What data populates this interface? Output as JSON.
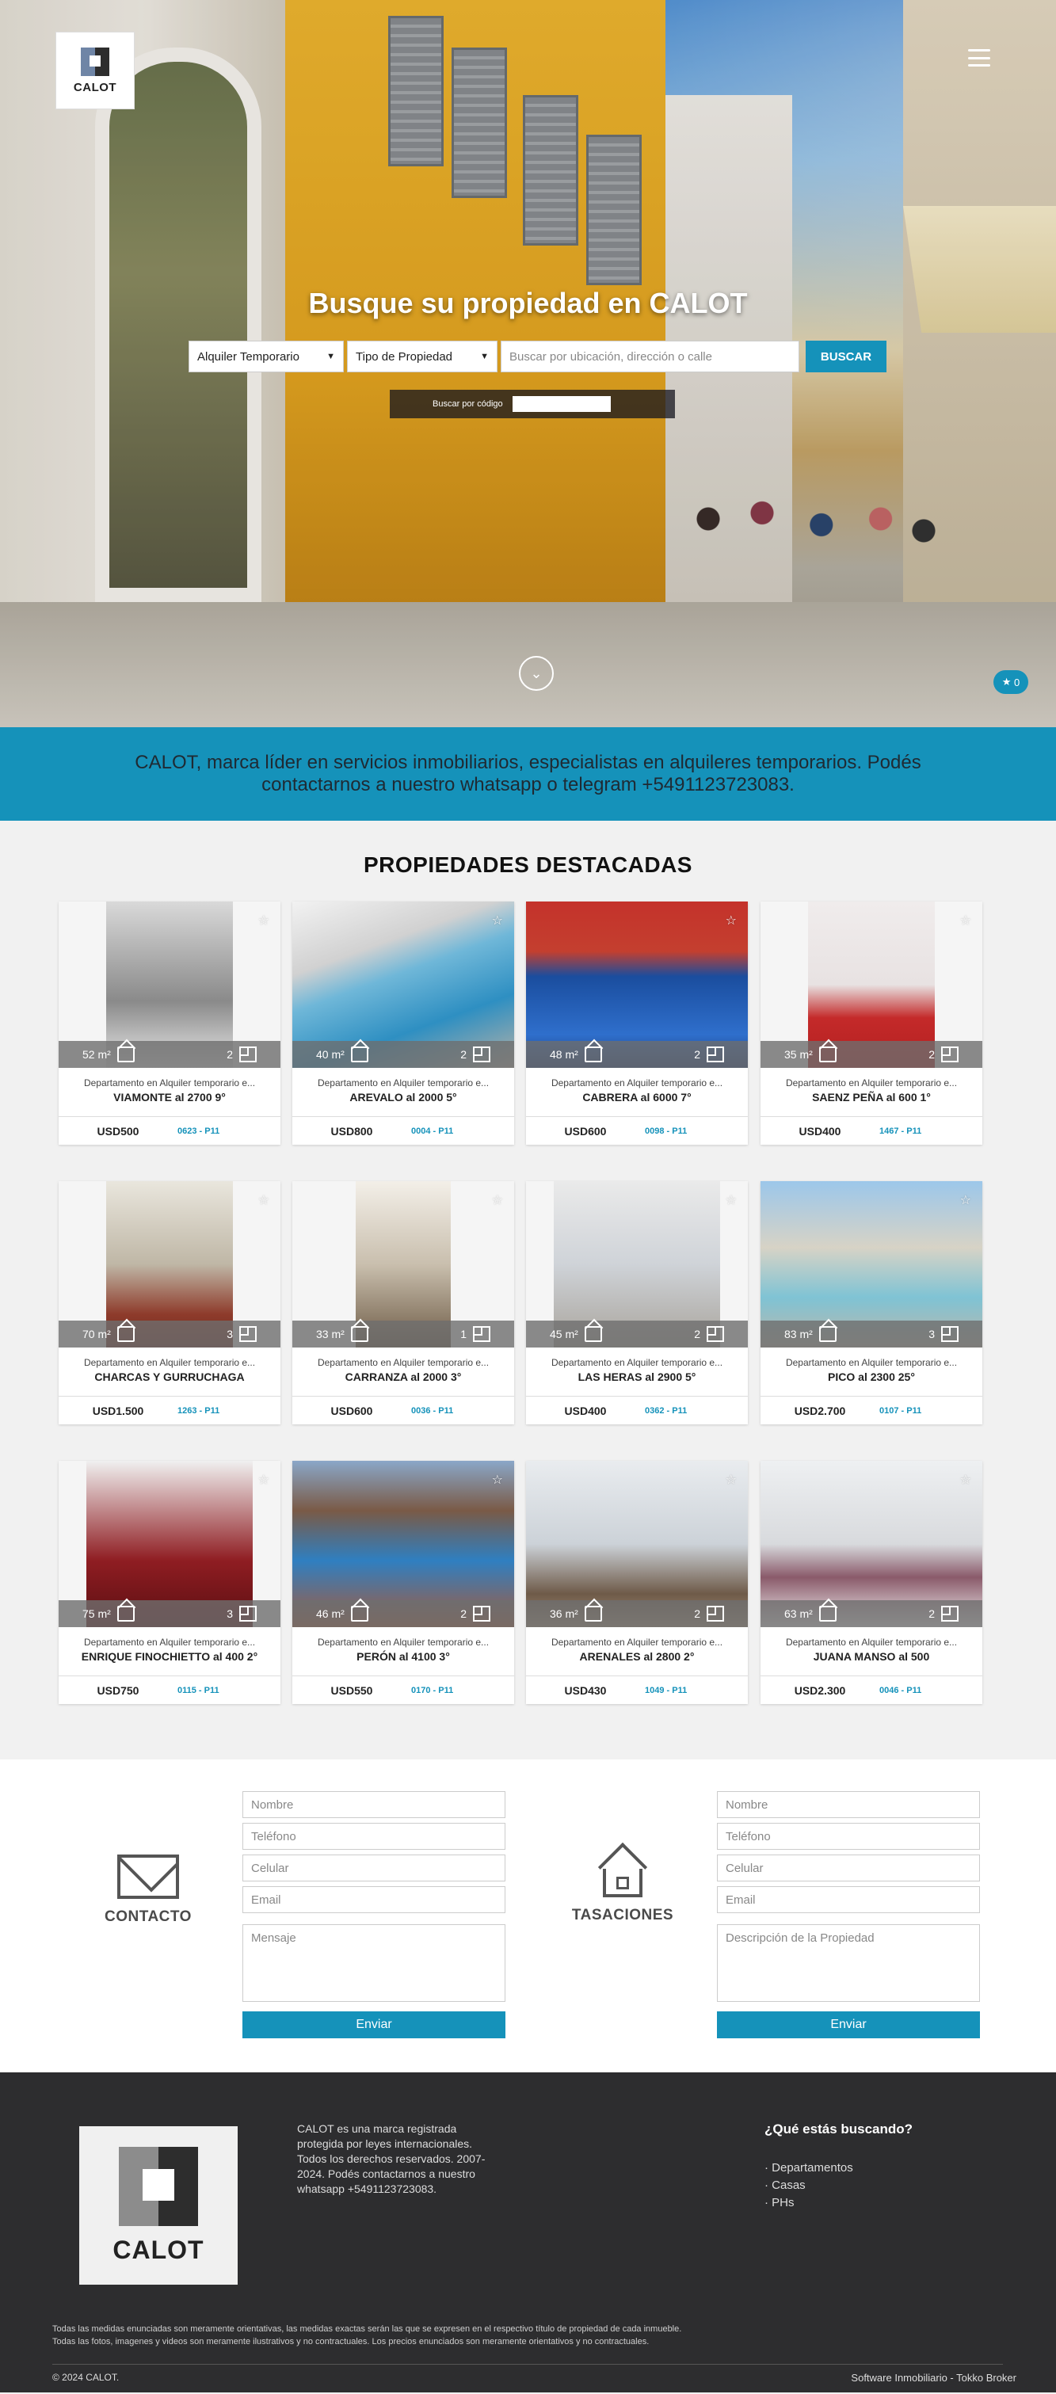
{
  "header": {
    "logo_text": "CALOT",
    "menu_icon": "hamburger-icon",
    "title": "Busque su propiedad en CALOT",
    "search": {
      "operation": "Alquiler Temporario",
      "property_type": "Tipo de Propiedad",
      "placeholder": "Buscar por ubicación, dirección o calle",
      "button": "BUSCAR",
      "code_label": "Buscar por código"
    },
    "favorites_count": "0"
  },
  "banner": {
    "text": "CALOT, marca líder en servicios inmobiliarios, especialistas en alquileres temporarios. Podés contactarnos a nuestro whatsapp o telegram +5491123723083."
  },
  "featured": {
    "title": "PROPIEDADES DESTACADAS",
    "cards": [
      {
        "area": "52 m²",
        "rooms": "2",
        "type": "Departamento en Alquiler temporario e...",
        "address": "VIAMONTE al 2700 9°",
        "price": "USD500",
        "code": "0623 - P11"
      },
      {
        "area": "40 m²",
        "rooms": "2",
        "type": "Departamento en Alquiler temporario e...",
        "address": "AREVALO al 2000 5°",
        "price": "USD800",
        "code": "0004 - P11"
      },
      {
        "area": "48 m²",
        "rooms": "2",
        "type": "Departamento en Alquiler temporario e...",
        "address": "CABRERA al 6000 7°",
        "price": "USD600",
        "code": "0098 - P11"
      },
      {
        "area": "35 m²",
        "rooms": "2",
        "type": "Departamento en Alquiler temporario e...",
        "address": "SAENZ PEÑA al 600 1°",
        "price": "USD400",
        "code": "1467 - P11"
      },
      {
        "area": "70 m²",
        "rooms": "3",
        "type": "Departamento en Alquiler temporario e...",
        "address": "CHARCAS Y GURRUCHAGA",
        "price": "USD1.500",
        "code": "1263 - P11"
      },
      {
        "area": "33 m²",
        "rooms": "1",
        "type": "Departamento en Alquiler temporario e...",
        "address": "CARRANZA al 2000 3°",
        "price": "USD600",
        "code": "0036 - P11"
      },
      {
        "area": "45 m²",
        "rooms": "2",
        "type": "Departamento en Alquiler temporario e...",
        "address": "LAS HERAS al 2900 5°",
        "price": "USD400",
        "code": "0362 - P11"
      },
      {
        "area": "83 m²",
        "rooms": "3",
        "type": "Departamento en Alquiler temporario e...",
        "address": "PICO al 2300 25°",
        "price": "USD2.700",
        "code": "0107 - P11"
      },
      {
        "area": "75 m²",
        "rooms": "3",
        "type": "Departamento en Alquiler temporario e...",
        "address": "ENRIQUE FINOCHIETTO al 400 2°",
        "price": "USD750",
        "code": "0115 - P11"
      },
      {
        "area": "46 m²",
        "rooms": "2",
        "type": "Departamento en Alquiler temporario e...",
        "address": "PERÓN al 4100 3°",
        "price": "USD550",
        "code": "0170 - P11"
      },
      {
        "area": "36 m²",
        "rooms": "2",
        "type": "Departamento en Alquiler temporario e...",
        "address": "ARENALES al 2800 2°",
        "price": "USD430",
        "code": "1049 - P11"
      },
      {
        "area": "63 m²",
        "rooms": "2",
        "type": "Departamento en Alquiler temporario e...",
        "address": "JUANA MANSO al 500",
        "price": "USD2.300",
        "code": "0046 - P11"
      }
    ]
  },
  "contact": {
    "title": "CONTACTO",
    "fields": [
      "Nombre",
      "Teléfono",
      "Celular",
      "Email"
    ],
    "message": "Mensaje",
    "button": "Enviar"
  },
  "appraisal": {
    "title": "TASACIONES",
    "fields": [
      "Nombre",
      "Teléfono",
      "Celular",
      "Email"
    ],
    "message": "Descripción de la Propiedad",
    "button": "Enviar"
  },
  "footer": {
    "logo_text": "CALOT",
    "about": "CALOT es una marca registrada protegida por leyes internacionales. Todos los derechos reservados. 2007-2024. Podés contactarnos a nuestro whatsapp +5491123723083.",
    "links_title": "¿Qué estás buscando?",
    "links": [
      "· Departamentos",
      "· Casas",
      "· PHs"
    ],
    "disclaimer_1": "Todas las medidas enunciadas son meramente orientativas, las medidas exactas serán las que se expresen en el respectivo título de propiedad de cada inmueble.",
    "disclaimer_2": "Todas las fotos, imagenes y videos son meramente ilustrativos y no contractuales. Los precios enunciados son meramente orientativos y no contractuales.",
    "copyright": "© 2024 CALOT.",
    "software": "Software Inmobiliario - Tokko Broker"
  },
  "colors": {
    "accent": "#1592ba",
    "footer_bg": "#2d2d2f",
    "page_bg": "#f1f1f1"
  }
}
